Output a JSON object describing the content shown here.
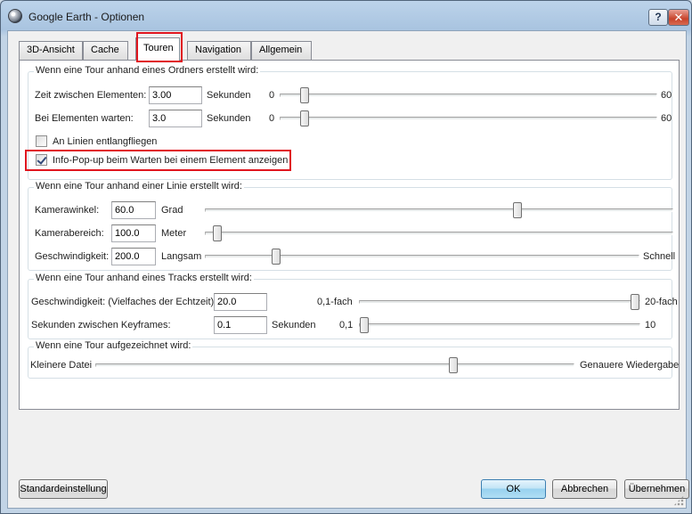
{
  "window": {
    "title": "Google Earth - Optionen",
    "help_label": "?",
    "close_label": "✕"
  },
  "tabs": [
    {
      "label": "3D-Ansicht"
    },
    {
      "label": "Cache"
    },
    {
      "label": "Touren",
      "active": true
    },
    {
      "label": "Navigation"
    },
    {
      "label": "Allgemein"
    }
  ],
  "folder_group": {
    "title": "Wenn eine Tour anhand eines Ordners erstellt wird:",
    "time_between": {
      "label": "Zeit zwischen Elementen:",
      "value": "3.00",
      "unit": "Sekunden",
      "min": "0",
      "max": "60",
      "level": 0.04
    },
    "wait_at": {
      "label": "Bei Elementen warten:",
      "value": "3.0",
      "unit": "Sekunden",
      "min": "0",
      "max": "60",
      "level": 0.04
    },
    "fly_along_lines": {
      "label": "An Linien entlangfliegen",
      "checked": false
    },
    "show_popup": {
      "label": "Info-Pop-up beim Warten bei einem Element anzeigen",
      "checked": true
    }
  },
  "line_group": {
    "title": "Wenn eine Tour anhand einer Linie erstellt wird:",
    "camera_angle": {
      "label": "Kamerawinkel:",
      "value": "60.0",
      "unit": "Grad",
      "level": 0.67
    },
    "camera_range": {
      "label": "Kamerabereich:",
      "value": "100.0",
      "unit": "Meter",
      "level": 0.02
    },
    "speed": {
      "label": "Geschwindigkeit:",
      "value": "200.0",
      "min": "Langsam",
      "max": "Schnell",
      "level": 0.15
    }
  },
  "tracks_group": {
    "title": "Wenn eine Tour anhand eines Tracks erstellt wird:",
    "speed": {
      "label": "Geschwindigkeit: (Vielfaches der Echtzeit)",
      "value": "20.0",
      "min": "0,1-fach",
      "max": "20-fach",
      "level": 1.0
    },
    "keyframes": {
      "label": "Sekunden zwischen Keyframes:",
      "value": "0.1",
      "unit": "Sekunden",
      "min": "0,1",
      "max": "10",
      "level": 0.0
    }
  },
  "record_group": {
    "title": "Wenn eine Tour aufgezeichnet wird:",
    "min": "Kleinere Datei",
    "max": "Genauere Wiedergabe",
    "level": 0.75
  },
  "buttons": {
    "defaults": "Standardeinstellung",
    "ok": "OK",
    "cancel": "Abbrechen",
    "apply": "Übernehmen"
  }
}
